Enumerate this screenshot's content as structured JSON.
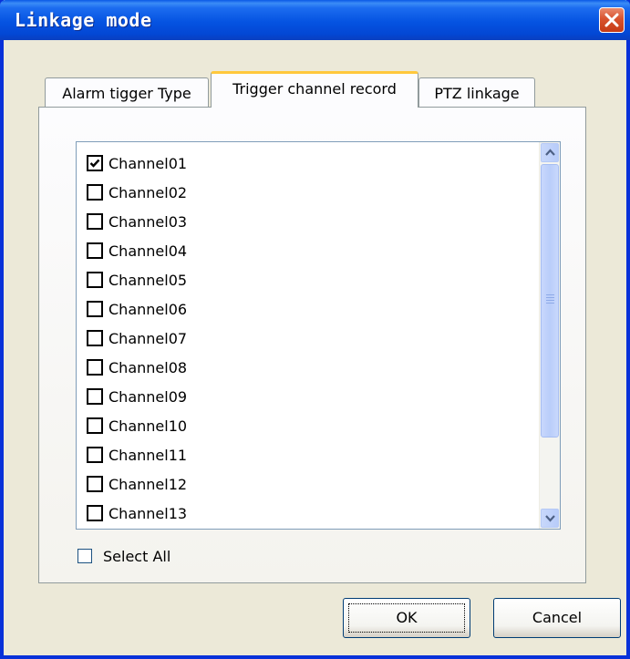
{
  "window": {
    "title": "Linkage mode"
  },
  "tabs": [
    {
      "label": "Alarm tigger Type",
      "active": false
    },
    {
      "label": "Trigger channel record",
      "active": true
    },
    {
      "label": "PTZ linkage",
      "active": false
    }
  ],
  "channels": [
    {
      "label": "Channel01",
      "checked": true
    },
    {
      "label": "Channel02",
      "checked": false
    },
    {
      "label": "Channel03",
      "checked": false
    },
    {
      "label": "Channel04",
      "checked": false
    },
    {
      "label": "Channel05",
      "checked": false
    },
    {
      "label": "Channel06",
      "checked": false
    },
    {
      "label": "Channel07",
      "checked": false
    },
    {
      "label": "Channel08",
      "checked": false
    },
    {
      "label": "Channel09",
      "checked": false
    },
    {
      "label": "Channel10",
      "checked": false
    },
    {
      "label": "Channel11",
      "checked": false
    },
    {
      "label": "Channel12",
      "checked": false
    },
    {
      "label": "Channel13",
      "checked": false
    }
  ],
  "select_all": {
    "label": "Select All",
    "checked": false
  },
  "buttons": {
    "ok": "OK",
    "cancel": "Cancel"
  },
  "colors": {
    "titlebar": "#0553e1",
    "dialog_bg": "#ece9d8",
    "active_tab_accent": "#ffc83c",
    "close_button": "#d8522e"
  }
}
